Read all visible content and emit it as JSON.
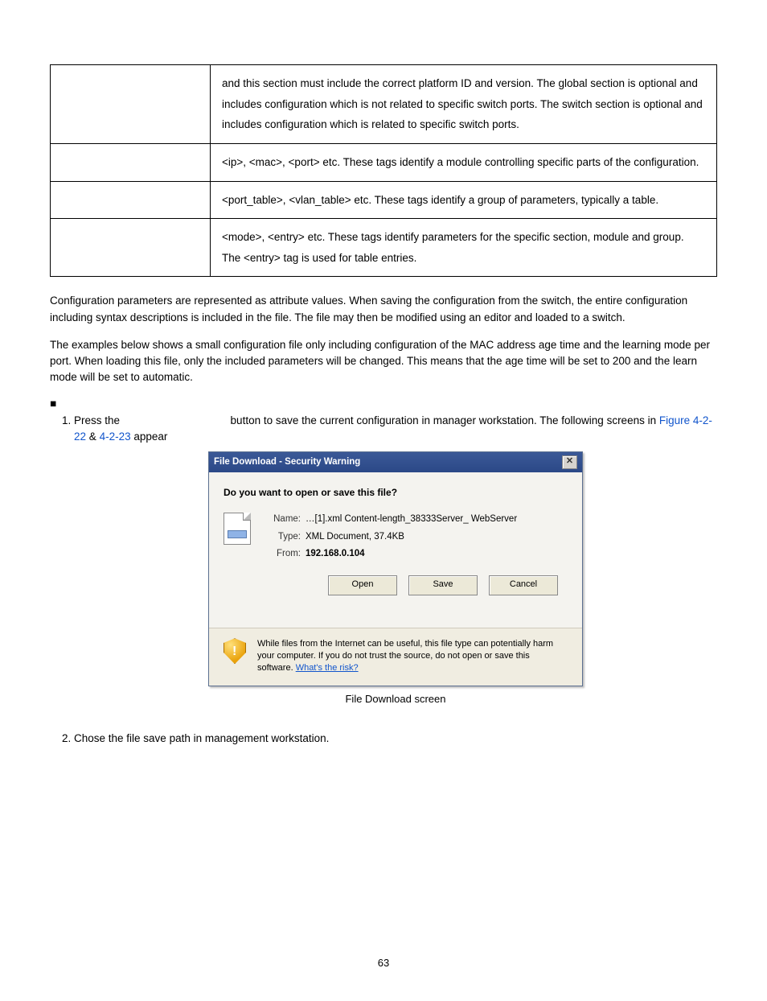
{
  "table": {
    "rows": [
      {
        "left": "",
        "right": "and this section must include the correct platform ID and version. The global section is optional and includes configuration which is not related to specific switch ports. The switch section is optional and includes configuration which is related to specific switch ports."
      },
      {
        "left": "",
        "right": "<ip>, <mac>, <port> etc. These tags identify a module controlling specific parts of the configuration."
      },
      {
        "left": "",
        "right": "<port_table>, <vlan_table> etc. These tags identify a group of parameters, typically a table."
      },
      {
        "left": "",
        "right": "<mode>, <entry> etc. These tags identify parameters for the specific section, module and group. The <entry> tag is used for table entries."
      }
    ]
  },
  "para1": "Configuration parameters are represented as attribute values. When saving the configuration from the switch, the entire configuration including syntax descriptions is included in the file. The file may then be modified using an editor and loaded to a switch.",
  "para2": "The examples below shows a small configuration file only including configuration of the MAC address age time and the learning mode per port. When loading this file, only the included parameters will be changed. This means that the age time will be set to 200 and the learn mode will be set to automatic.",
  "bullet": "■",
  "step1_a": "Press the ",
  "step1_b": " button to save the current configuration in manager workstation. The following screens in ",
  "fig1": "Figure 4-2-22",
  "amp": " & ",
  "fig2": "4-2-23",
  "appear": " appear",
  "dialog": {
    "title": "File Download - Security Warning",
    "question": "Do you want to open or save this file?",
    "name_label": "Name:",
    "name": "…[1].xml Content-length_38333Server_ WebServer",
    "type_label": "Type:",
    "type": "XML Document, 37.4KB",
    "from_label": "From:",
    "from": "192.168.0.104",
    "open": "Open",
    "save": "Save",
    "cancel": "Cancel",
    "warn": "While files from the Internet can be useful, this file type can potentially harm your computer. If you do not trust the source, do not open or save this software. ",
    "risk": "What's the risk?"
  },
  "caption": "File Download screen",
  "step2": "Chose the file save path in management workstation.",
  "pagenum": "63"
}
